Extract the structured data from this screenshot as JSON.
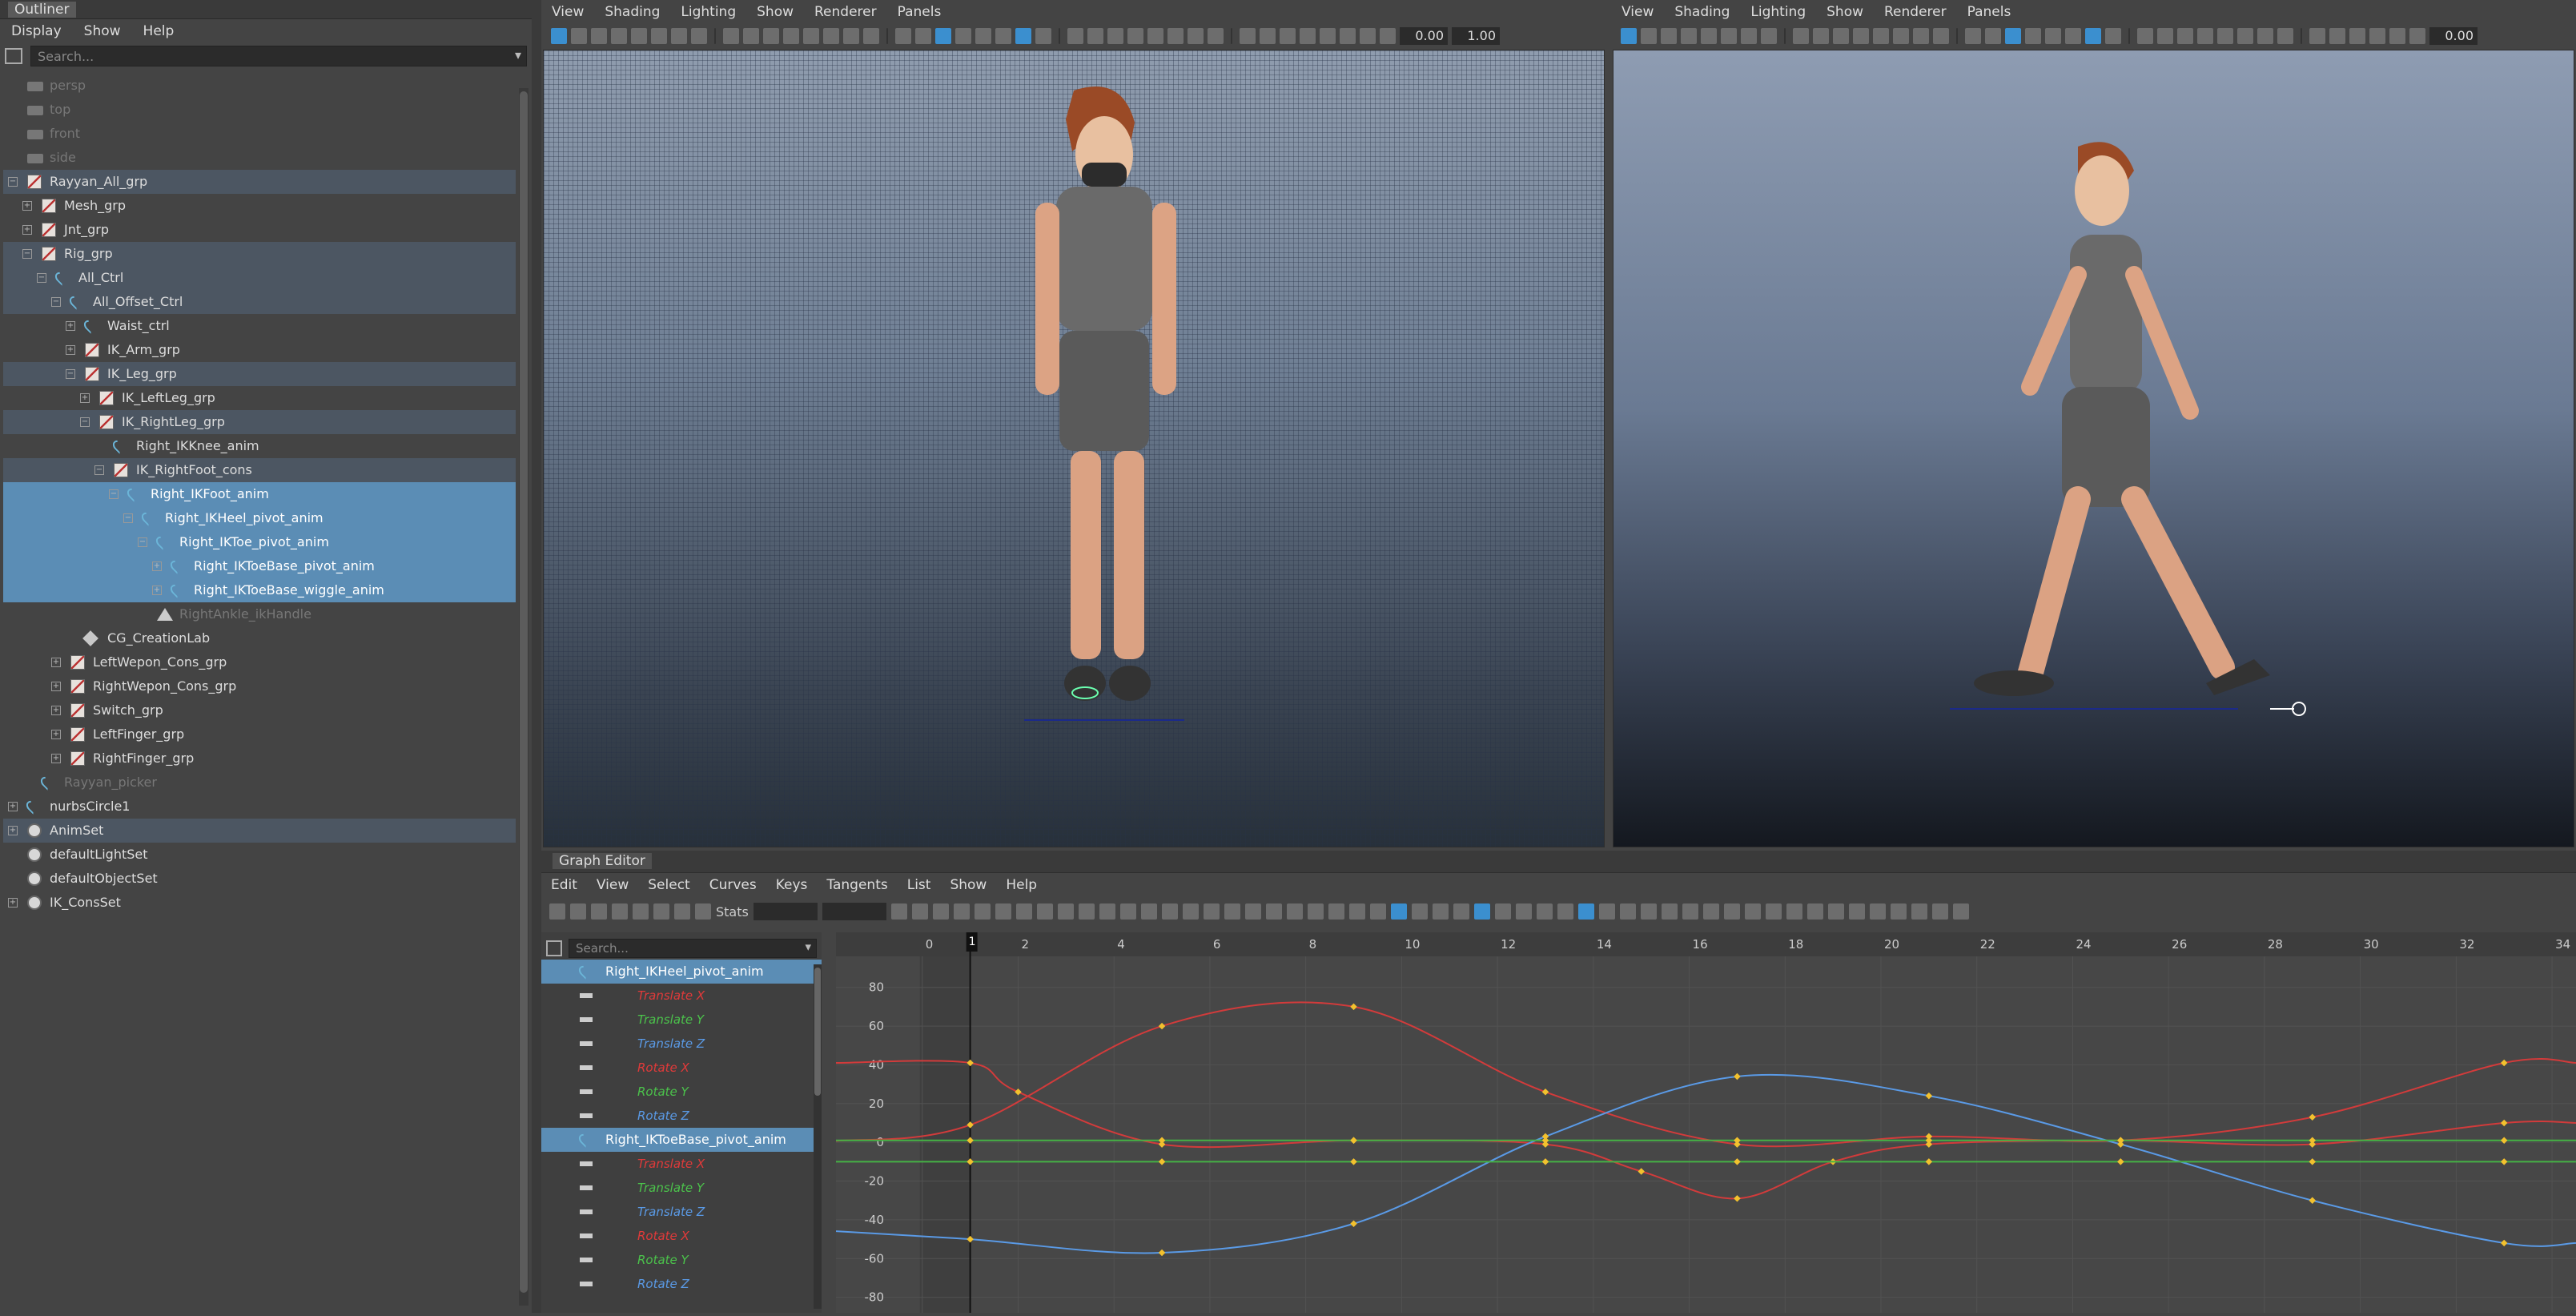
{
  "outliner": {
    "title": "Outliner",
    "menu": [
      "Display",
      "Show",
      "Help"
    ],
    "search_placeholder": "Search...",
    "items": [
      {
        "label": "persp",
        "indent": 0,
        "icon": "camera-icon",
        "state": "dim",
        "exp": ""
      },
      {
        "label": "top",
        "indent": 0,
        "icon": "camera-icon",
        "state": "dim",
        "exp": ""
      },
      {
        "label": "front",
        "indent": 0,
        "icon": "camera-icon",
        "state": "dim",
        "exp": ""
      },
      {
        "label": "side",
        "indent": 0,
        "icon": "camera-icon",
        "state": "dim",
        "exp": ""
      },
      {
        "label": "Rayyan_All_grp",
        "indent": 0,
        "icon": "transform-icon",
        "state": "hl",
        "exp": "-"
      },
      {
        "label": "Mesh_grp",
        "indent": 1,
        "icon": "transform-icon",
        "state": "",
        "exp": "+"
      },
      {
        "label": "Jnt_grp",
        "indent": 1,
        "icon": "transform-icon",
        "state": "",
        "exp": "+"
      },
      {
        "label": "Rig_grp",
        "indent": 1,
        "icon": "transform-icon",
        "state": "hl",
        "exp": "-"
      },
      {
        "label": "All_Ctrl",
        "indent": 2,
        "icon": "curve-icon",
        "state": "hl",
        "exp": "-"
      },
      {
        "label": "All_Offset_Ctrl",
        "indent": 3,
        "icon": "curve-icon",
        "state": "hl",
        "exp": "-"
      },
      {
        "label": "Waist_ctrl",
        "indent": 4,
        "icon": "curve-icon",
        "state": "",
        "exp": "+"
      },
      {
        "label": "IK_Arm_grp",
        "indent": 4,
        "icon": "transform-icon",
        "state": "",
        "exp": "+"
      },
      {
        "label": "IK_Leg_grp",
        "indent": 4,
        "icon": "transform-icon",
        "state": "hl",
        "exp": "-"
      },
      {
        "label": "IK_LeftLeg_grp",
        "indent": 5,
        "icon": "transform-icon",
        "state": "",
        "exp": "+"
      },
      {
        "label": "IK_RightLeg_grp",
        "indent": 5,
        "icon": "transform-icon",
        "state": "hl",
        "exp": "-"
      },
      {
        "label": "Right_IKKnee_anim",
        "indent": 6,
        "icon": "curve-icon",
        "state": "",
        "exp": ""
      },
      {
        "label": "IK_RightFoot_cons",
        "indent": 6,
        "icon": "transform-icon",
        "state": "hl",
        "exp": "-"
      },
      {
        "label": "Right_IKFoot_anim",
        "indent": 7,
        "icon": "curve-icon",
        "state": "sel",
        "exp": "-"
      },
      {
        "label": "Right_IKHeel_pivot_anim",
        "indent": 8,
        "icon": "curve-icon",
        "state": "sel",
        "exp": "-"
      },
      {
        "label": "Right_IKToe_pivot_anim",
        "indent": 9,
        "icon": "curve-icon",
        "state": "sel",
        "exp": "-"
      },
      {
        "label": "Right_IKToeBase_pivot_anim",
        "indent": 10,
        "icon": "curve-icon",
        "state": "sel",
        "exp": "+"
      },
      {
        "label": "Right_IKToeBase_wiggle_anim",
        "indent": 10,
        "icon": "curve-icon",
        "state": "sel",
        "exp": "+"
      },
      {
        "label": "RightAnkle_ikHandle",
        "indent": 9,
        "icon": "ikhandle-icon",
        "state": "dim",
        "exp": ""
      },
      {
        "label": "CG_CreationLab",
        "indent": 4,
        "icon": "locator-icon",
        "state": "",
        "exp": ""
      },
      {
        "label": "LeftWepon_Cons_grp",
        "indent": 3,
        "icon": "transform-icon",
        "state": "",
        "exp": "+"
      },
      {
        "label": "RightWepon_Cons_grp",
        "indent": 3,
        "icon": "transform-icon",
        "state": "",
        "exp": "+"
      },
      {
        "label": "Switch_grp",
        "indent": 3,
        "icon": "transform-icon",
        "state": "",
        "exp": "+"
      },
      {
        "label": "LeftFinger_grp",
        "indent": 3,
        "icon": "transform-icon",
        "state": "",
        "exp": "+"
      },
      {
        "label": "RightFinger_grp",
        "indent": 3,
        "icon": "transform-icon",
        "state": "",
        "exp": "+"
      },
      {
        "label": "Rayyan_picker",
        "indent": 1,
        "icon": "picker-icon",
        "state": "dim",
        "exp": ""
      },
      {
        "label": "nurbsCircle1",
        "indent": 0,
        "icon": "curve-icon",
        "state": "",
        "exp": "+"
      },
      {
        "label": "AnimSet",
        "indent": 0,
        "icon": "set-icon",
        "state": "hl",
        "exp": "+"
      },
      {
        "label": "defaultLightSet",
        "indent": 0,
        "icon": "set-icon",
        "state": "",
        "exp": ""
      },
      {
        "label": "defaultObjectSet",
        "indent": 0,
        "icon": "set-icon",
        "state": "",
        "exp": ""
      },
      {
        "label": "IK_ConsSet",
        "indent": 0,
        "icon": "set-icon",
        "state": "",
        "exp": "+"
      }
    ]
  },
  "viewport_left": {
    "menu": [
      "View",
      "Shading",
      "Lighting",
      "Show",
      "Renderer",
      "Panels"
    ],
    "near_value": "0.00",
    "far_value": "1.00"
  },
  "viewport_right": {
    "menu": [
      "View",
      "Shading",
      "Lighting",
      "Show",
      "Renderer",
      "Panels"
    ],
    "near_value": "0.00"
  },
  "graph_editor": {
    "title": "Graph Editor",
    "menu": [
      "Edit",
      "View",
      "Select",
      "Curves",
      "Keys",
      "Tangents",
      "List",
      "Show",
      "Help"
    ],
    "stats_label": "Stats",
    "search_placeholder": "Search...",
    "channels": [
      {
        "type": "obj",
        "label": "Right_IKHeel_pivot_anim"
      },
      {
        "type": "attr",
        "label": "Translate X",
        "color": "#e03a3a"
      },
      {
        "type": "attr",
        "label": "Translate Y",
        "color": "#4bc24b"
      },
      {
        "type": "attr",
        "label": "Translate Z",
        "color": "#5a9ae6"
      },
      {
        "type": "attr",
        "label": "Rotate X",
        "color": "#e03a3a"
      },
      {
        "type": "attr",
        "label": "Rotate Y",
        "color": "#4bc24b"
      },
      {
        "type": "attr",
        "label": "Rotate Z",
        "color": "#5a9ae6"
      },
      {
        "type": "obj",
        "label": "Right_IKToeBase_pivot_anim"
      },
      {
        "type": "attr",
        "label": "Translate X",
        "color": "#e03a3a"
      },
      {
        "type": "attr",
        "label": "Translate Y",
        "color": "#4bc24b"
      },
      {
        "type": "attr",
        "label": "Translate Z",
        "color": "#5a9ae6"
      },
      {
        "type": "attr",
        "label": "Rotate X",
        "color": "#e03a3a"
      },
      {
        "type": "attr",
        "label": "Rotate Y",
        "color": "#4bc24b"
      },
      {
        "type": "attr",
        "label": "Rotate Z",
        "color": "#5a9ae6"
      }
    ],
    "current_frame": "1",
    "frame_ticks": [
      "0",
      "2",
      "4",
      "6",
      "8",
      "10",
      "12",
      "14",
      "16",
      "18",
      "20",
      "22",
      "24",
      "26",
      "28",
      "30",
      "32",
      "34"
    ],
    "value_ticks": [
      "80",
      "60",
      "40",
      "20",
      "0",
      "-20",
      "-40",
      "-60",
      "-80"
    ]
  },
  "chart_data": {
    "type": "line",
    "xlabel": "",
    "ylabel": "",
    "xlim": [
      -1.8,
      34.5
    ],
    "ylim": [
      -88,
      96
    ],
    "series": [
      {
        "color": "#d23b3b",
        "x": [
          1,
          5,
          9,
          13,
          17,
          21,
          25,
          29,
          33
        ],
        "y": [
          9,
          60,
          70,
          26,
          -1,
          3,
          1,
          13,
          41
        ]
      },
      {
        "color": "#d23b3b",
        "x": [
          1,
          2,
          5,
          9,
          13,
          15,
          17,
          19,
          21,
          25,
          29,
          33
        ],
        "y": [
          41,
          26,
          -1,
          1,
          -1,
          -15,
          -29,
          -10,
          -1,
          1,
          -1,
          10
        ]
      },
      {
        "color": "#5a9ae6",
        "x": [
          1,
          5,
          9,
          13,
          17,
          21,
          25,
          29,
          33
        ],
        "y": [
          -50,
          -57,
          -42,
          3,
          34,
          24,
          -1,
          -30,
          -52
        ]
      },
      {
        "color": "#45b245",
        "x": [
          1,
          5,
          9,
          13,
          17,
          21,
          25,
          29,
          33
        ],
        "y": [
          1,
          1,
          1,
          1,
          1,
          1,
          1,
          1,
          1
        ]
      },
      {
        "color": "#45b245",
        "x": [
          1,
          5,
          9,
          13,
          17,
          21,
          25,
          29,
          33
        ],
        "y": [
          -10,
          -10,
          -10,
          -10,
          -10,
          -10,
          -10,
          -10,
          -10
        ]
      }
    ],
    "grid": true,
    "key_color": "#f2c12e"
  }
}
